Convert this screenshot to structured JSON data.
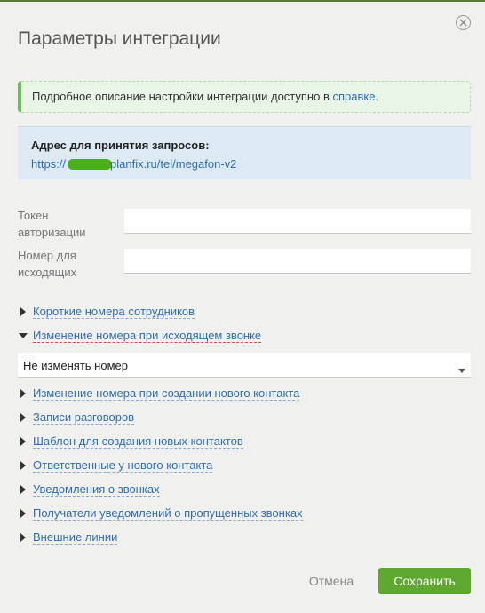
{
  "dialog": {
    "title": "Параметры интеграции"
  },
  "info": {
    "text": "Подробное описание настройки интеграции доступно в ",
    "link": "справке",
    "suffix": "."
  },
  "address": {
    "label": "Адрес для принятия запросов:",
    "url_prefix": "https://",
    "url_suffix": "planfix.ru/tel/megafon-v2"
  },
  "fields": {
    "token_label_line1": "Токен",
    "token_label_line2": "авторизации",
    "token_value": "",
    "outgoing_label_line1": "Номер для",
    "outgoing_label_line2": "исходящих",
    "outgoing_value": ""
  },
  "sections": {
    "short_numbers": "Короткие номера сотрудников",
    "outgoing_change": "Изменение номера при исходящем звонке",
    "outgoing_select": "Не изменять номер",
    "new_contact_change": "Изменение номера при создании нового контакта",
    "recordings": "Записи разговоров",
    "template": "Шаблон для создания новых контактов",
    "responsible": "Ответственные у нового контакта",
    "notifications": "Уведомления о звонках",
    "missed_recipients": "Получатели уведомлений о пропущенных звонках",
    "external_lines": "Внешние линии"
  },
  "buttons": {
    "cancel": "Отмена",
    "save": "Сохранить"
  },
  "colors": {
    "accent_green": "#5ea82f",
    "link_blue": "#2e6db3"
  }
}
